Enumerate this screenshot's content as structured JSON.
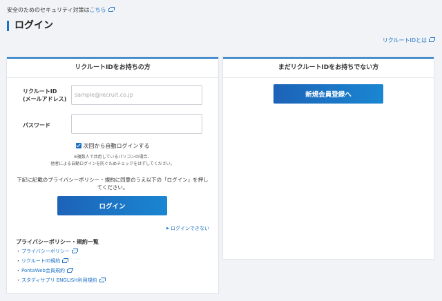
{
  "notice": {
    "text": "安全のためのセキュリティ対策は",
    "link_label": "こちら"
  },
  "page_title": "ログイン",
  "about_id_link": "リクルートIDとは",
  "left_panel": {
    "header": "リクルートIDをお持ちの方",
    "id_label_line1": "リクルートID",
    "id_label_line2": "(メールアドレス)",
    "id_placeholder": "sample@recruit.co.jp",
    "id_value": "",
    "password_label": "パスワード",
    "password_value": "",
    "auto_login_label": "次回から自動ログインする",
    "auto_login_checked": true,
    "note_line1": "※複数人で共用しているパソコンの場合、",
    "note_line2": "他者による自動ログインを防ぐためチェックをはずしてください。",
    "agree_text": "下記に記載のプライバシーポリシー・規約に同意のうえ以下の「ログイン」を押してください。",
    "login_button": "ログイン",
    "cant_login_link": "ログインできない",
    "policy_title": "プライバシーポリシー・規約一覧",
    "policy_links": [
      "プライバシーポリシー",
      "リクルートID規約",
      "PontaWeb会員規約",
      "スタディサプリ ENGLISH利用規約"
    ]
  },
  "right_panel": {
    "header": "まだリクルートIDをお持ちでない方",
    "register_button": "新規会員登録へ"
  },
  "colors": {
    "accent": "#1a73c8",
    "link": "#1a6fc4",
    "background": "#f1f3f6"
  },
  "icons": {
    "external_link": "external-window-icon",
    "arrow": "chevron-right-icon",
    "checkbox": "checkbox-checked-icon"
  }
}
